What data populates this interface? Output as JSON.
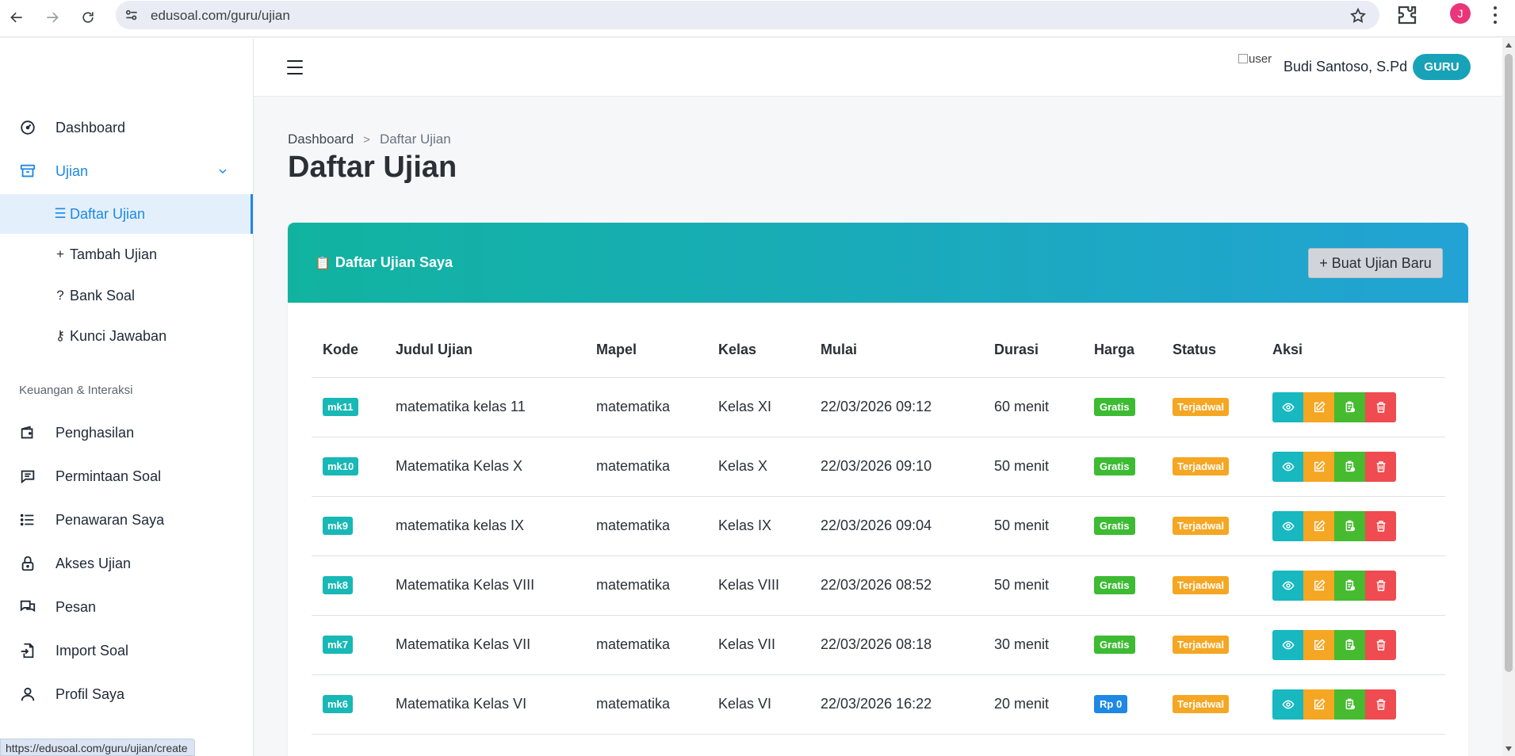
{
  "browser": {
    "url": "edusoal.com/guru/ujian",
    "profile_initial": "J",
    "status_url": "https://edusoal.com/guru/ujian/create"
  },
  "sidebar": {
    "items": [
      {
        "label": "Dashboard",
        "icon": "dashboard-icon"
      },
      {
        "label": "Ujian",
        "icon": "archive-icon"
      }
    ],
    "ujian_submenu": [
      {
        "label": "Daftar Ujian",
        "glyph": "☰"
      },
      {
        "label": "Tambah Ujian",
        "glyph": "+"
      },
      {
        "label": "Bank Soal",
        "glyph": "?"
      },
      {
        "label": "Kunci Jawaban",
        "glyph": "⚷"
      }
    ],
    "section_label": "Keuangan & Interaksi",
    "section_items": [
      {
        "label": "Penghasilan",
        "icon": "wallet-icon"
      },
      {
        "label": "Permintaan Soal",
        "icon": "chat-icon"
      },
      {
        "label": "Penawaran Saya",
        "icon": "list-icon"
      },
      {
        "label": "Akses Ujian",
        "icon": "lock-icon"
      },
      {
        "label": "Pesan",
        "icon": "messages-icon"
      },
      {
        "label": "Import Soal",
        "icon": "file-import-icon"
      },
      {
        "label": "Profil Saya",
        "icon": "user-icon"
      }
    ]
  },
  "topbar": {
    "avatar_alt": "user",
    "user_name": "Budi Santoso, S.Pd",
    "role": "GURU"
  },
  "breadcrumb": {
    "home": "Dashboard",
    "current": "Daftar Ujian"
  },
  "page_title": "Daftar Ujian",
  "card": {
    "title": "Daftar Ujian Saya",
    "new_button": "+ Buat Ujian Baru"
  },
  "table": {
    "headers": [
      "Kode",
      "Judul Ujian",
      "Mapel",
      "Kelas",
      "Mulai",
      "Durasi",
      "Harga",
      "Status",
      "Aksi"
    ],
    "rows": [
      {
        "kode": "mk11",
        "judul": "matematika kelas 11",
        "mapel": "matematika",
        "kelas": "Kelas XI",
        "mulai": "22/03/2026 09:12",
        "durasi": "60 menit",
        "harga": "Gratis",
        "status": "Terjadwal"
      },
      {
        "kode": "mk10",
        "judul": "Matematika Kelas X",
        "mapel": "matematika",
        "kelas": "Kelas X",
        "mulai": "22/03/2026 09:10",
        "durasi": "50 menit",
        "harga": "Gratis",
        "status": "Terjadwal"
      },
      {
        "kode": "mk9",
        "judul": "matematika kelas IX",
        "mapel": "matematika",
        "kelas": "Kelas IX",
        "mulai": "22/03/2026 09:04",
        "durasi": "50 menit",
        "harga": "Gratis",
        "status": "Terjadwal"
      },
      {
        "kode": "mk8",
        "judul": "Matematika Kelas VIII",
        "mapel": "matematika",
        "kelas": "Kelas VIII",
        "mulai": "22/03/2026 08:52",
        "durasi": "50 menit",
        "harga": "Gratis",
        "status": "Terjadwal"
      },
      {
        "kode": "mk7",
        "judul": "Matematika Kelas VII",
        "mapel": "matematika",
        "kelas": "Kelas VII",
        "mulai": "22/03/2026 08:18",
        "durasi": "30 menit",
        "harga": "Gratis",
        "status": "Terjadwal"
      },
      {
        "kode": "mk6",
        "judul": "Matematika Kelas VI",
        "mapel": "matematika",
        "kelas": "Kelas VI",
        "mulai": "22/03/2026 16:22",
        "durasi": "20 menit",
        "harga": "Rp 0",
        "status": "Terjadwal"
      }
    ]
  },
  "colors": {
    "accent": "#1e88e5",
    "header_gradient_start": "#11b3a0",
    "header_gradient_end": "#22a3d4",
    "badge_teal": "#17b8b5",
    "badge_green": "#3dbb33",
    "badge_orange": "#f5a623",
    "badge_red": "#ef4b50"
  }
}
